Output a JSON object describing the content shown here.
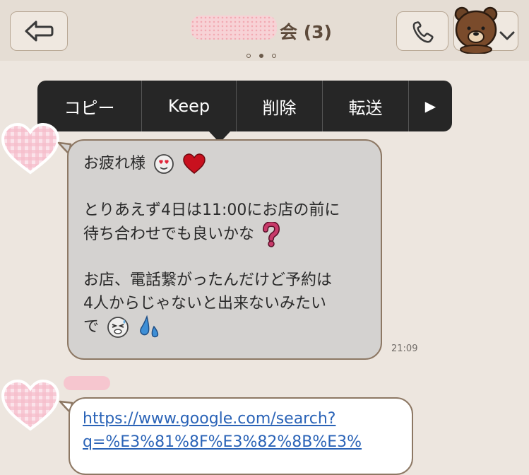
{
  "header": {
    "title": "会 (3)",
    "pager": [
      false,
      true,
      false
    ],
    "back_icon": "back-arrow-icon",
    "call_icon": "phone-icon",
    "menu_icon": "brown-bear-icon"
  },
  "context_menu": {
    "items": [
      "コピー",
      "Keep",
      "削除",
      "転送",
      "▶"
    ]
  },
  "message1": {
    "lines": [
      "お疲れ様",
      "",
      "とりあえず4日は11:00にお店の前に",
      "待ち合わせでも良いかな",
      "",
      "お店、電話繋がったんだけど予約は",
      "4人からじゃないと出来ないみたい",
      "で"
    ],
    "time": "21:09"
  },
  "message2": {
    "link_lines": [
      "https://www.google.com/search?",
      "q=%E3%81%8F%E3%82%8B%E3%"
    ]
  },
  "colors": {
    "header_bg": "#e5ddd4",
    "chat_bg": "#ede6df",
    "bubble_border": "#8d7864",
    "selected_bubble": "#d4d2d0",
    "menu_bg": "#262626",
    "link": "#2a63b7"
  }
}
